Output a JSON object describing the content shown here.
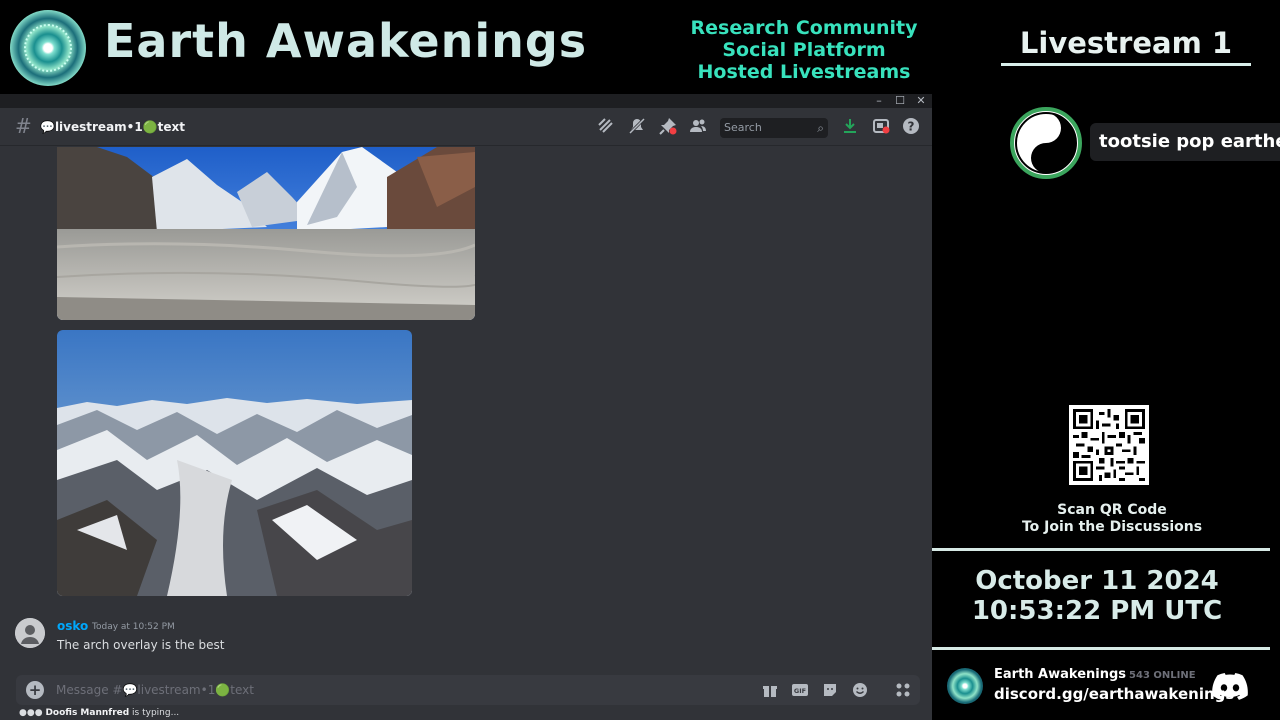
{
  "banner": {
    "title": "Earth Awakenings",
    "taglines": [
      "Research Community",
      "Social Platform",
      "Hosted Livestreams"
    ]
  },
  "sidebar": {
    "stream_title": "Livestream 1",
    "participant_name": "tootsie pop earther",
    "qr_caption": [
      "Scan QR Code",
      "To Join the Discussions"
    ],
    "date": "October 11 2024",
    "time": "10:53:22 PM UTC",
    "server_name": "Earth Awakenings",
    "online_count": "543 ONLINE",
    "invite": "discord.gg/earthawakenings"
  },
  "window": {
    "controls": [
      "–",
      "☐",
      "✕"
    ]
  },
  "header": {
    "channel_name": "💬livestream•1🟢text",
    "search_placeholder": "Search",
    "icons": [
      "threads-icon",
      "mute-icon",
      "pin-icon",
      "members-icon",
      "download-icon",
      "inbox-icon",
      "help-icon"
    ]
  },
  "message": {
    "author": "osko",
    "timestamp": "Today at 10:52 PM",
    "text": "The arch overlay is the best"
  },
  "composer": {
    "placeholder": "Message #💬livestream•1🟢text",
    "icons": [
      "gift-icon",
      "gif-icon",
      "sticker-icon",
      "emoji-icon",
      "apps-icon"
    ]
  },
  "typing": {
    "name": "Doofis Mannfred",
    "suffix": " is typing..."
  },
  "colors": {
    "tagline": "#38e2bd",
    "link": "#00a8fc",
    "online_ring": "#3ba55d",
    "background": "#313338"
  }
}
